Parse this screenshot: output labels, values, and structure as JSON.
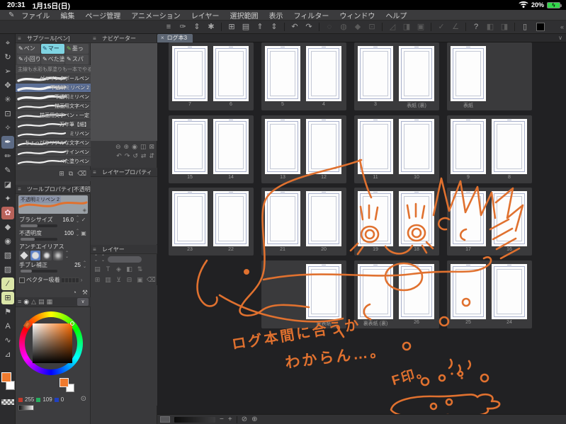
{
  "status_bar": {
    "time": "20:31",
    "date": "1月15日(日)",
    "battery_percent": "20%",
    "battery_charging_glyph": "ϟ",
    "wifi_icon": "wifi-icon"
  },
  "menu_bar": {
    "logo_glyph": "✎",
    "items": [
      "ファイル",
      "編集",
      "ページ管理",
      "アニメーション",
      "レイヤー",
      "選択範囲",
      "表示",
      "フィルター",
      "ウィンドウ",
      "ヘルプ"
    ]
  },
  "toolbar": {
    "color_swatch": "#000000",
    "collapse_glyph": "«",
    "buttons": [
      {
        "name": "main-menu-icon",
        "glyph": "≡"
      },
      {
        "name": "pen-settings-icon",
        "glyph": "✑"
      },
      {
        "name": "toolbar-expand-icon",
        "glyph": "⇕"
      },
      {
        "name": "quick-access-icon",
        "glyph": "✱"
      },
      {
        "divider": true
      },
      {
        "name": "new-canvas-icon",
        "glyph": "⊞"
      },
      {
        "name": "open-file-icon",
        "glyph": "▤"
      },
      {
        "name": "export-icon",
        "glyph": "⇑"
      },
      {
        "name": "export-expand-icon",
        "glyph": "⇕"
      },
      {
        "divider": true
      },
      {
        "name": "undo-icon",
        "glyph": "↶"
      },
      {
        "name": "redo-icon",
        "glyph": "↷"
      },
      {
        "divider": true
      },
      {
        "name": "deselect-icon",
        "glyph": "◌",
        "dim": true
      },
      {
        "name": "reselect-icon",
        "glyph": "◍",
        "dim": true
      },
      {
        "name": "invert-selection-icon",
        "glyph": "◆",
        "dim": true
      },
      {
        "name": "crop-selection-icon",
        "glyph": "⊡",
        "dim": true
      },
      {
        "divider": true
      },
      {
        "name": "ruler-snap-icon",
        "glyph": "◿",
        "dim": true
      },
      {
        "name": "special-ruler-snap-icon",
        "glyph": "◨",
        "dim": true
      },
      {
        "name": "grid-snap-icon",
        "glyph": "▣",
        "dim": true
      },
      {
        "divider": true
      },
      {
        "name": "check-line-icon",
        "glyph": "✓",
        "dim": true
      },
      {
        "name": "angle-line-icon",
        "glyph": "∠",
        "dim": true
      },
      {
        "divider": true
      },
      {
        "name": "help-icon",
        "glyph": "?",
        "dim": false
      },
      {
        "name": "prev-page-icon",
        "glyph": "◧",
        "dim": true
      },
      {
        "name": "next-page-icon",
        "glyph": "◨",
        "dim": true
      },
      {
        "divider": true
      },
      {
        "name": "device-settings-icon",
        "glyph": "▯"
      }
    ]
  },
  "left_toolbar": {
    "foreground_color": "#ef7a2e",
    "background_color": "#ffffff",
    "tools": [
      {
        "name": "zoom-tool",
        "glyph": "⌖"
      },
      {
        "name": "rotate-canvas-tool",
        "glyph": "↻"
      },
      {
        "name": "operation-tool",
        "glyph": "➢"
      },
      {
        "name": "move-tool",
        "glyph": "✥"
      },
      {
        "name": "auto-select-tool",
        "glyph": "✳"
      },
      {
        "name": "marquee-select-tool",
        "glyph": "⊡"
      },
      {
        "name": "eyedropper-tool",
        "glyph": "✧"
      },
      {
        "name": "pen-tool",
        "glyph": "✒",
        "active": true
      },
      {
        "name": "pencil-tool",
        "glyph": "✏"
      },
      {
        "name": "marker-tool",
        "glyph": "✎"
      },
      {
        "name": "eraser-tool",
        "glyph": "◪"
      },
      {
        "name": "airbrush-tool",
        "glyph": "✦"
      },
      {
        "name": "decoration-tool",
        "glyph": "✿",
        "accent": "pink"
      },
      {
        "name": "hard-eraser-tool",
        "glyph": "◆"
      },
      {
        "name": "blend-tool",
        "glyph": "◉"
      },
      {
        "name": "gradient-tool",
        "glyph": "▧"
      },
      {
        "name": "fill-tool",
        "glyph": "▨"
      },
      {
        "name": "line-tool",
        "glyph": "∕",
        "accent": "yellow"
      },
      {
        "name": "frame-border-tool",
        "glyph": "⊞",
        "accent": "yellow"
      },
      {
        "name": "flow-tool",
        "glyph": "⚑"
      },
      {
        "name": "text-tool",
        "glyph": "A"
      },
      {
        "name": "curve-tool",
        "glyph": "∿"
      },
      {
        "name": "ruler-tool",
        "glyph": "⊿"
      }
    ]
  },
  "subtool_panel": {
    "title": "サブツール[ペン]",
    "tabs": [
      {
        "label": "ペン",
        "color": ""
      },
      {
        "label": "マー",
        "color": "cyan"
      },
      {
        "label": "墨っ",
        "color": "green"
      },
      {
        "label": "小回り",
        "color": ""
      },
      {
        "label": "べた塗",
        "color": ""
      },
      {
        "label": "スパ",
        "color": ""
      }
    ],
    "description": "主線も水彩も厚塗りも一本でやる",
    "brushes": [
      {
        "name": "ゲルインクボールペン",
        "selected": false
      },
      {
        "name": "不透明ミリペン 2",
        "selected": true
      },
      {
        "name": "不透明ミリペン",
        "selected": false
      },
      {
        "name": "描画用文字ペン",
        "selected": false
      },
      {
        "name": "描画用文字ペン・一定",
        "selected": false
      },
      {
        "name": "万年筆【細】",
        "selected": false
      },
      {
        "name": "ミリペン",
        "selected": false
      },
      {
        "name": "ちょっぴりリアルな文字ペン",
        "selected": false
      },
      {
        "name": "サインペン",
        "selected": false
      },
      {
        "name": "べた塗りペン",
        "selected": false
      }
    ],
    "footer_icons": [
      {
        "name": "add-subtool-icon",
        "glyph": "⊞"
      },
      {
        "name": "duplicate-subtool-icon",
        "glyph": "⧉"
      },
      {
        "name": "delete-subtool-icon",
        "glyph": "⌫"
      }
    ]
  },
  "tool_property_panel": {
    "title": "ツールプロパティ[不透明…",
    "brush_name": "不透明ミリペン 2",
    "properties": [
      {
        "label": "ブラシサイズ",
        "value": "16.0"
      },
      {
        "label": "不透明度",
        "value": "100"
      },
      {
        "label": "アンチエイリアス",
        "value": ""
      },
      {
        "label": "手ブレ補正",
        "value": "25"
      }
    ],
    "vector_snap_label": "ベクター吸着",
    "footer_icons": [
      {
        "name": "reset-tool-icon",
        "glyph": "◔"
      },
      {
        "name": "tool-settings-wrench-icon",
        "glyph": "⚒"
      }
    ]
  },
  "navigator_panel": {
    "title": "ナビゲーター",
    "controls_row1": [
      {
        "name": "zoom-out-icon",
        "glyph": "⊖"
      },
      {
        "name": "zoom-in-icon",
        "glyph": "⊕"
      },
      {
        "name": "zoom-reset-icon",
        "glyph": "◉"
      },
      {
        "name": "flip-horizontal-icon",
        "glyph": "◫"
      },
      {
        "name": "fit-screen-icon",
        "glyph": "⊠"
      }
    ],
    "controls_row2": [
      {
        "name": "rotate-left-icon",
        "glyph": "↶"
      },
      {
        "name": "rotate-right-icon",
        "glyph": "↷"
      },
      {
        "name": "rotate-reset-icon",
        "glyph": "↺"
      },
      {
        "name": "mirror-icon",
        "glyph": "⇄"
      },
      {
        "name": "fit-height-icon",
        "glyph": "⇵"
      }
    ]
  },
  "layer_property_panel": {
    "title": "レイヤープロパティ"
  },
  "layer_panel": {
    "title": "レイヤー",
    "icons_row1": [
      {
        "name": "layer-folder-icon",
        "glyph": "▤"
      },
      {
        "name": "layer-text-icon",
        "glyph": "T"
      },
      {
        "name": "layer-lock-icon",
        "glyph": "◈"
      },
      {
        "name": "layer-mask-icon",
        "glyph": "◧"
      },
      {
        "name": "layer-expand-icon",
        "glyph": "⇅"
      }
    ],
    "icons_row2": [
      {
        "name": "new-layer-icon",
        "glyph": "⊞"
      },
      {
        "name": "new-folder-icon",
        "glyph": "▥"
      },
      {
        "name": "transfer-layer-icon",
        "glyph": "⊻"
      },
      {
        "name": "merge-layer-icon",
        "glyph": "⊟"
      },
      {
        "name": "fill-layer-icon",
        "glyph": "▣"
      },
      {
        "name": "delete-layer-icon",
        "glyph": "⌫"
      }
    ]
  },
  "color_panel": {
    "tabs": [
      {
        "name": "color-wheel-tab",
        "glyph": "◉",
        "active": true
      },
      {
        "name": "color-triangle-tab",
        "glyph": "△",
        "active": false
      },
      {
        "name": "color-slider-tab",
        "glyph": "▤",
        "active": false
      },
      {
        "name": "color-set-tab",
        "glyph": "▦",
        "active": false
      }
    ],
    "r": "255",
    "g": "109",
    "b": "0",
    "selected_color": "#ff6d00"
  },
  "canvas": {
    "tab": {
      "close_glyph": "×",
      "label": "ログ本3"
    },
    "page_rows": [
      {
        "containers": [
          {
            "pages": [
              "7",
              "6"
            ]
          },
          {
            "pages": [
              "5",
              "4"
            ]
          },
          {
            "pages": [
              "3",
              "表紙 (裏)"
            ]
          },
          {
            "pages": [
              "表紙"
            ],
            "align": "left"
          }
        ]
      },
      {
        "containers": [
          {
            "pages": [
              "15",
              "14"
            ]
          },
          {
            "pages": [
              "13",
              "12"
            ]
          },
          {
            "pages": [
              "11",
              "10"
            ]
          },
          {
            "pages": [
              "9",
              "8"
            ]
          }
        ]
      },
      {
        "containers": [
          {
            "pages": [
              "23",
              "22"
            ]
          },
          {
            "pages": [
              "21",
              "20"
            ]
          },
          {
            "pages": [
              "19",
              "18"
            ]
          },
          {
            "pages": [
              "17",
              "16"
            ]
          }
        ]
      },
      {
        "containers": [
          {
            "empty": true
          },
          {
            "pages": [
              "裏表紙"
            ],
            "align": "right"
          },
          {
            "pages": [
              "裏表紙 (裏)",
              "26"
            ]
          },
          {
            "pages": [
              "25",
              "24"
            ]
          }
        ]
      }
    ],
    "annotations": {
      "ink_color": "#e0712f",
      "line1": "ログ本間に合うか",
      "line2": "わからん…。",
      "line3": "F印。"
    },
    "bottom_bar": {
      "zoom_out": "−",
      "zoom_in": "+",
      "icons": [
        {
          "name": "zoom-percent-icon",
          "glyph": "⊘"
        },
        {
          "name": "fit-canvas-icon",
          "glyph": "⊕"
        }
      ]
    }
  }
}
